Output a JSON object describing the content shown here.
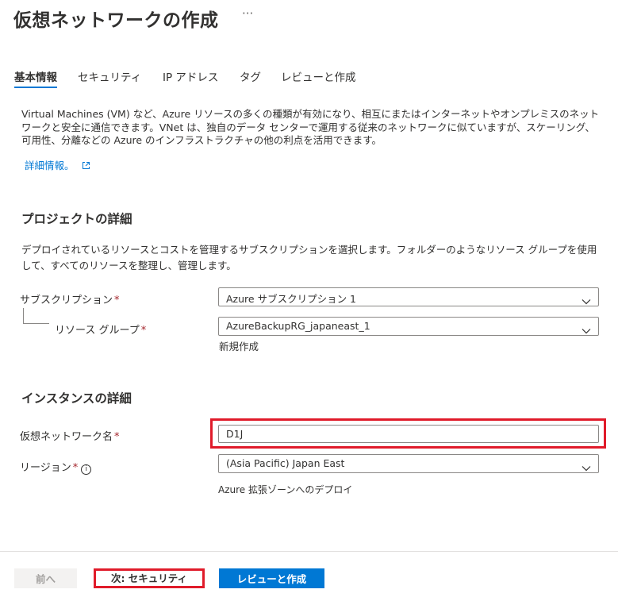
{
  "page": {
    "title": "仮想ネットワークの作成",
    "more_label": "···"
  },
  "tabs": [
    {
      "label": "基本情報",
      "active": true
    },
    {
      "label": "セキュリティ",
      "active": false
    },
    {
      "label": "IP アドレス",
      "active": false
    },
    {
      "label": "タグ",
      "active": false
    },
    {
      "label": "レビューと作成",
      "active": false
    }
  ],
  "intro": {
    "description": "Virtual Machines (VM) など、Azure リソースの多くの種類が有効になり、相互にまたはインターネットやオンプレミスのネットワークと安全に通信できます。VNet は、独自のデータ センターで運用する従来のネットワークに似ていますが、スケーリング、可用性、分離などの Azure のインフラストラクチャの他の利点を活用できます。",
    "learn_more_link": "詳細情報。",
    "external_link_icon": "external-link-icon"
  },
  "project": {
    "heading": "プロジェクトの詳細",
    "description": "デプロイされているリソースとコストを管理するサブスクリプションを選択します。フォルダーのようなリソース グループを使用して、すべてのリソースを整理し、管理します。",
    "subscription_label": "サブスクリプション",
    "subscription_value": "Azure サブスクリプション 1",
    "resource_group_label": "リソース グループ",
    "resource_group_value": "AzureBackupRG_japaneast_1",
    "create_new_link": "新規作成",
    "required_mark": "*"
  },
  "instance": {
    "heading": "インスタンスの詳細",
    "vnet_name_label": "仮想ネットワーク名",
    "vnet_name_value": "D1J",
    "region_label": "リージョン",
    "region_value": "(Asia Pacific) Japan East",
    "info_icon_glyph": "i",
    "edge_zone_link": "Azure 拡張ゾーンへのデプロイ",
    "required_mark": "*"
  },
  "footer": {
    "prev_label": "前へ",
    "next_label": "次: セキュリティ",
    "review_label": "レビューと作成"
  },
  "colors": {
    "accent": "#0078d4",
    "required": "#a4262c",
    "highlight": "#e01b2a"
  }
}
